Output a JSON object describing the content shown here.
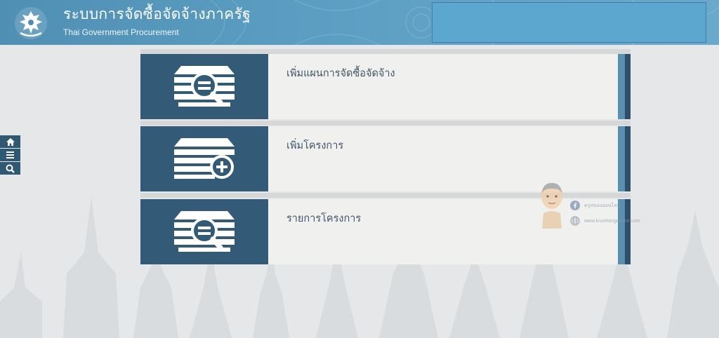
{
  "header": {
    "title": "ระบบการจัดซื้อจัดจ้างภาครัฐ",
    "subtitle": "Thai Government Procurement",
    "logo_icon": "garuda-emblem-icon"
  },
  "side_toolbar": [
    {
      "icon": "home-icon"
    },
    {
      "icon": "menu-icon"
    },
    {
      "icon": "search-icon"
    }
  ],
  "menu_cards": [
    {
      "label": "เพิ่มแผนการจัดซื้อจัดจ้าง",
      "icon": "document-search-icon"
    },
    {
      "label": "เพิ่มโครงการ",
      "icon": "document-add-icon"
    },
    {
      "label": "รายการโครงการ",
      "icon": "document-search-icon"
    }
  ],
  "watermark": {
    "facebook": "ครูหนองออนไลน์",
    "website": "www.krunhongonline.com"
  },
  "colors": {
    "header": "#5b9dc2",
    "card_icon_bg": "#335a77",
    "card_bg": "#f0f0ef",
    "page_bg": "#e6e7e8"
  }
}
